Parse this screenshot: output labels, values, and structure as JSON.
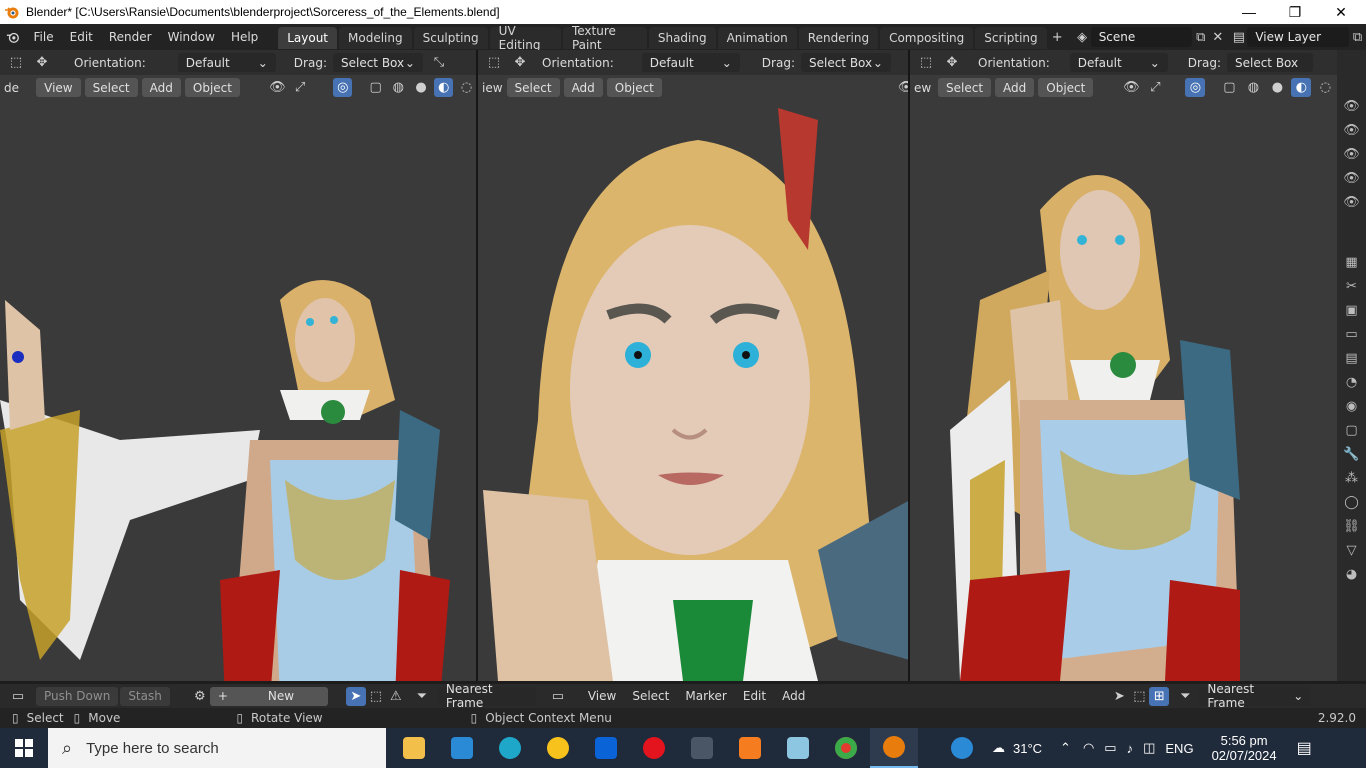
{
  "window": {
    "title": "Blender* [C:\\Users\\Ransie\\Documents\\blenderproject\\Sorceress_of_the_Elements.blend]",
    "minimize": "—",
    "restore": "❐",
    "close": "✕"
  },
  "menu": [
    "File",
    "Edit",
    "Render",
    "Window",
    "Help"
  ],
  "workspaces": [
    "Layout",
    "Modeling",
    "Sculpting",
    "UV Editing",
    "Texture Paint",
    "Shading",
    "Animation",
    "Rendering",
    "Compositing",
    "Scripting"
  ],
  "active_workspace": "Layout",
  "scene": {
    "label": "Scene",
    "view_layer": "View Layer"
  },
  "viewport_header": {
    "orientation_label": "Orientation:",
    "orientation_value": "Default",
    "drag_label": "Drag:",
    "drag_value": "Select Box",
    "view": "View",
    "select": "Select",
    "add": "Add",
    "object": "Object",
    "mode_fragment_left": "de",
    "view_fragment_middle": "iew",
    "view_fragment_right": "ew"
  },
  "timeline": {
    "push_down": "Push Down",
    "stash": "Stash",
    "new": "New",
    "nearest_frame": "Nearest Frame",
    "view": "View",
    "select": "Select",
    "marker": "Marker",
    "edit": "Edit",
    "add": "Add"
  },
  "status": {
    "select": "Select",
    "move": "Move",
    "rotate_view": "Rotate View",
    "context_menu": "Object Context Menu",
    "version": "2.92.0"
  },
  "taskbar": {
    "search_placeholder": "Type here to search",
    "temperature": "31°C",
    "language": "ENG",
    "time": "5:56 pm",
    "date": "02/07/2024"
  },
  "colors": {
    "accent": "#4772b3",
    "active_tab": "#3d3d3d",
    "viewport_bg": "#3a3a3a"
  }
}
